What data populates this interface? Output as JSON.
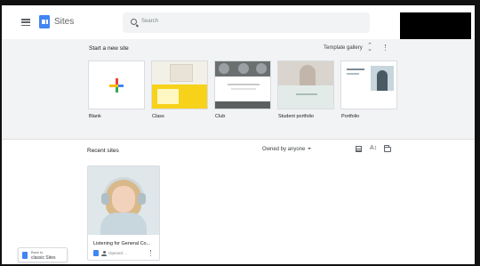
{
  "header": {
    "app_title": "Sites",
    "search_placeholder": "Search"
  },
  "gallery": {
    "heading": "Start a new site",
    "template_gallery_label": "Template gallery",
    "templates": [
      {
        "label": "Blank"
      },
      {
        "label": "Class"
      },
      {
        "label": "Club"
      },
      {
        "label": "Student portfolio"
      },
      {
        "label": "Portfolio"
      }
    ]
  },
  "recent": {
    "heading": "Recent sites",
    "owner_filter": "Owned by anyone",
    "sites": [
      {
        "title": "Listening for General Co...",
        "meta": "Opened ..."
      }
    ]
  },
  "classic": {
    "line1": "Back to",
    "line2": "classic Sites"
  },
  "colors": {
    "accent": "#4285f4",
    "gallery_bg": "#f1f3f4",
    "class_yellow": "#f7d21a"
  }
}
